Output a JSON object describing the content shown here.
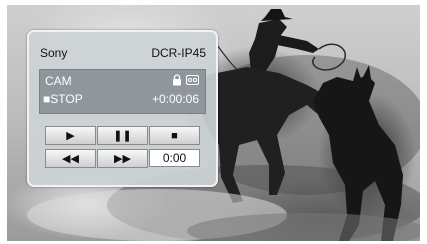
{
  "device": {
    "brand": "Sony",
    "model": "DCR-IP45"
  },
  "status": {
    "mode": "CAM",
    "state": "■STOP",
    "timecode": "+0:00:06",
    "icons": [
      "lock-icon",
      "tape-icon"
    ]
  },
  "controls": {
    "play": "▶",
    "pause": "❚❚",
    "stop": "■",
    "rewind": "◀◀",
    "fast_forward": "▶▶",
    "counter": "0:00"
  },
  "colors": {
    "panel_bg": "#cdd2d6",
    "status_bg": "#8f969c",
    "status_text": "#ffffff"
  }
}
